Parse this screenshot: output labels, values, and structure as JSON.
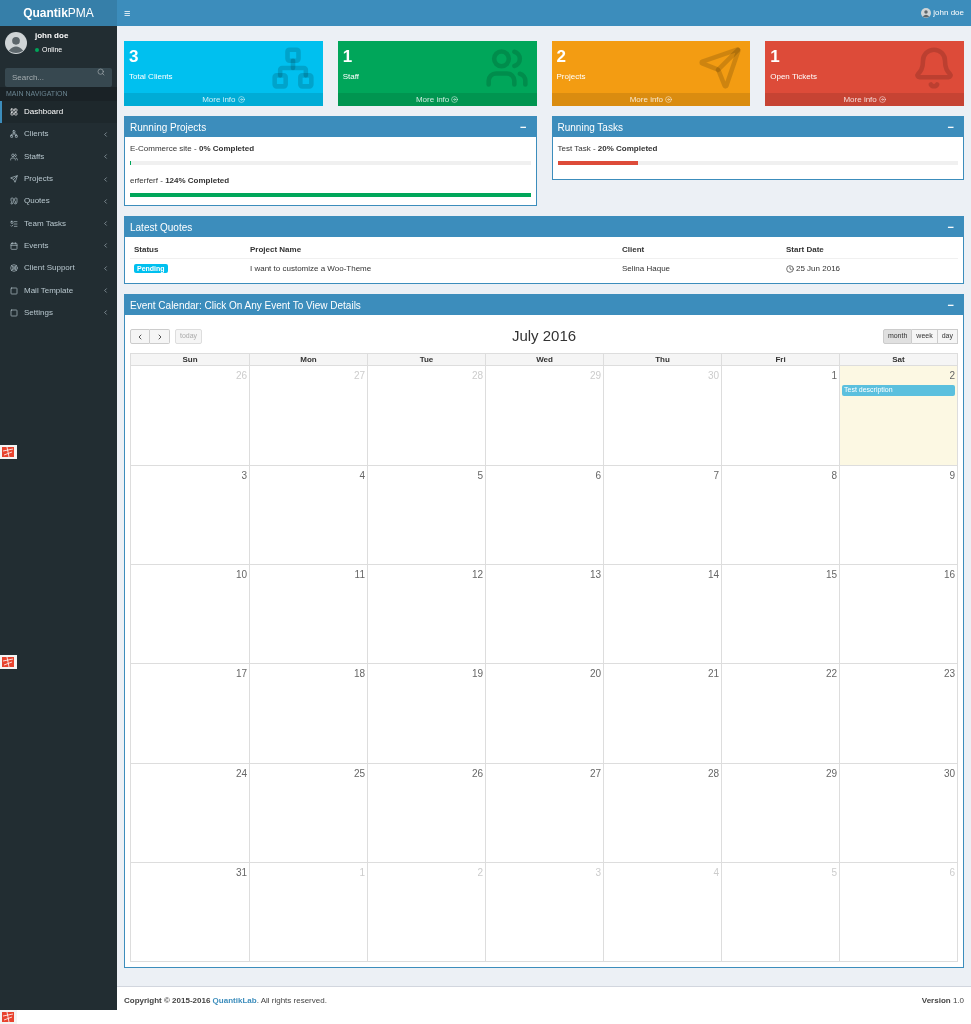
{
  "brand": {
    "bold": "Quantik",
    "light": "PMA"
  },
  "topbar": {
    "menu_icon": "≡",
    "user": "john doe"
  },
  "user_panel": {
    "name": "john doe",
    "status": "Online"
  },
  "search": {
    "placeholder": "Search..."
  },
  "sidebar": {
    "header": "MAIN NAVIGATION",
    "items": [
      {
        "label": "Dashboard",
        "selected": true,
        "has_children": false
      },
      {
        "label": "Clients",
        "selected": false,
        "has_children": true
      },
      {
        "label": "Staffs",
        "selected": false,
        "has_children": true
      },
      {
        "label": "Projects",
        "selected": false,
        "has_children": true
      },
      {
        "label": "Quotes",
        "selected": false,
        "has_children": true
      },
      {
        "label": "Team Tasks",
        "selected": false,
        "has_children": true
      },
      {
        "label": "Events",
        "selected": false,
        "has_children": true
      },
      {
        "label": "Client Support",
        "selected": false,
        "has_children": true
      },
      {
        "label": "Mail Template",
        "selected": false,
        "has_children": true
      },
      {
        "label": "Settings",
        "selected": false,
        "has_children": true
      }
    ]
  },
  "stat_cards": [
    {
      "value": "3",
      "label": "Total Clients",
      "link": "More info",
      "color": "#00c0ef"
    },
    {
      "value": "1",
      "label": "Staff",
      "link": "More info",
      "color": "#00a65a"
    },
    {
      "value": "2",
      "label": "Projects",
      "link": "More info",
      "color": "#f39c12"
    },
    {
      "value": "1",
      "label": "Open Tickets",
      "link": "More info",
      "color": "#dd4b39"
    }
  ],
  "running_projects": {
    "title": "Running Projects",
    "collapse": "−",
    "items": [
      {
        "name": "E-Commerce site",
        "separator": "-",
        "progress": "0% Completed",
        "level": 0
      },
      {
        "name": "erferferf",
        "separator": "-",
        "progress": "124% Completed",
        "level": 1,
        "color": "#00a65a"
      }
    ]
  },
  "running_tasks": {
    "title": "Running Tasks",
    "collapse": "−",
    "items": [
      {
        "name": "Test Task",
        "separator": "-",
        "progress": "20% Completed",
        "level": 0.2,
        "color": "#dd4b39"
      }
    ]
  },
  "latest_quotes": {
    "title": "Latest Quotes",
    "collapse": "−",
    "columns": [
      "Status",
      "Project Name",
      "Client",
      "Start Date"
    ],
    "rows": [
      {
        "status": "Pending",
        "project": "I want to customize a Woo-Theme",
        "client": "Selina Haque",
        "start_date": "25 Jun 2016"
      }
    ]
  },
  "calendar": {
    "title": "Event Calendar: Click On Any Event To View Details",
    "collapse": "−",
    "month": "July 2016",
    "today_button": {
      "label": "today",
      "disabled": true
    },
    "views": [
      {
        "label": "month",
        "selected": true
      },
      {
        "label": "week",
        "selected": false
      },
      {
        "label": "day",
        "selected": false
      }
    ],
    "weekdays": [
      "Sun",
      "Mon",
      "Tue",
      "Wed",
      "Thu",
      "Fri",
      "Sat"
    ],
    "weeks": [
      [
        {
          "day": "26",
          "other": true
        },
        {
          "day": "27",
          "other": true
        },
        {
          "day": "28",
          "other": true
        },
        {
          "day": "29",
          "other": true
        },
        {
          "day": "30",
          "other": true
        },
        {
          "day": "1",
          "other": false
        },
        {
          "day": "2",
          "other": false,
          "today": true,
          "events": [
            "Test description"
          ]
        }
      ],
      [
        {
          "day": "3",
          "other": false
        },
        {
          "day": "4",
          "other": false
        },
        {
          "day": "5",
          "other": false
        },
        {
          "day": "6",
          "other": false
        },
        {
          "day": "7",
          "other": false
        },
        {
          "day": "8",
          "other": false
        },
        {
          "day": "9",
          "other": false
        }
      ],
      [
        {
          "day": "10",
          "other": false
        },
        {
          "day": "11",
          "other": false
        },
        {
          "day": "12",
          "other": false
        },
        {
          "day": "13",
          "other": false
        },
        {
          "day": "14",
          "other": false
        },
        {
          "day": "15",
          "other": false
        },
        {
          "day": "16",
          "other": false
        }
      ],
      [
        {
          "day": "17",
          "other": false
        },
        {
          "day": "18",
          "other": false
        },
        {
          "day": "19",
          "other": false
        },
        {
          "day": "20",
          "other": false
        },
        {
          "day": "21",
          "other": false
        },
        {
          "day": "22",
          "other": false
        },
        {
          "day": "23",
          "other": false
        }
      ],
      [
        {
          "day": "24",
          "other": false
        },
        {
          "day": "25",
          "other": false
        },
        {
          "day": "26",
          "other": false
        },
        {
          "day": "27",
          "other": false
        },
        {
          "day": "28",
          "other": false
        },
        {
          "day": "29",
          "other": false
        },
        {
          "day": "30",
          "other": false
        }
      ],
      [
        {
          "day": "31",
          "other": false
        },
        {
          "day": "1",
          "other": true
        },
        {
          "day": "2",
          "other": true
        },
        {
          "day": "3",
          "other": true
        },
        {
          "day": "4",
          "other": true
        },
        {
          "day": "5",
          "other": true
        },
        {
          "day": "6",
          "other": true
        }
      ]
    ]
  },
  "footer": {
    "copyright": "Copyright © 2015-2016",
    "company": "QuantikLab",
    "rights": ". All rights reserved.",
    "version": "**Version** 1.0"
  }
}
